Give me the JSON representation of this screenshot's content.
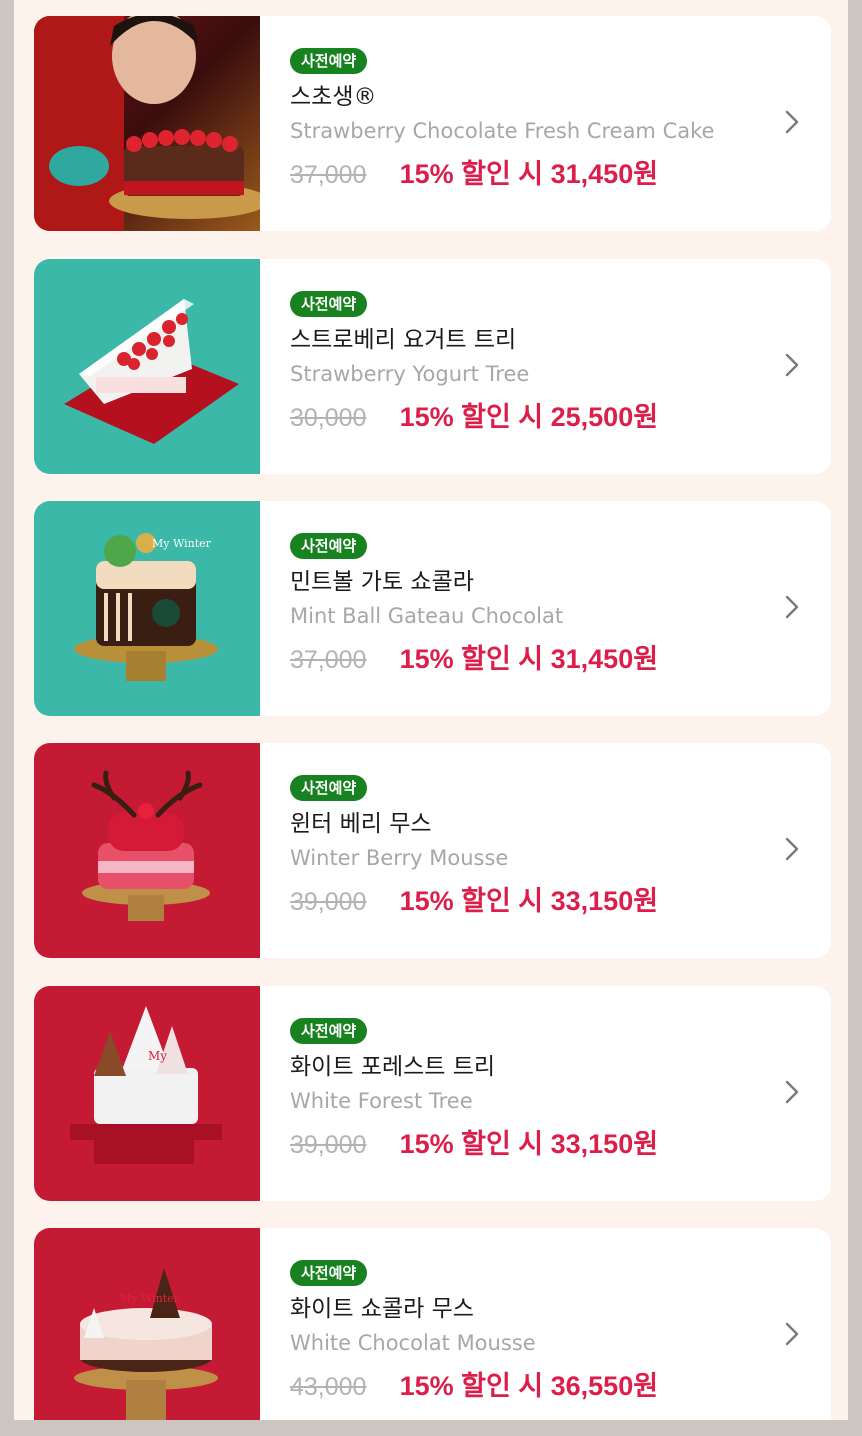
{
  "products": [
    {
      "badge": "사전예약",
      "name_ko": "스초생®",
      "name_en": "Strawberry Chocolate Fresh Cream Cake",
      "original_price": "37,000",
      "sale_text": "15% 할인 시 31,450원",
      "image_theme": "photo-dark-red"
    },
    {
      "badge": "사전예약",
      "name_ko": "스트로베리 요거트 트리",
      "name_en": "Strawberry Yogurt Tree",
      "original_price": "30,000",
      "sale_text": "15% 할인 시 25,500원",
      "image_theme": "mint"
    },
    {
      "badge": "사전예약",
      "name_ko": "민트볼 가토 쇼콜라",
      "name_en": "Mint Ball Gateau Chocolat",
      "original_price": "37,000",
      "sale_text": "15% 할인 시 31,450원",
      "image_theme": "mint"
    },
    {
      "badge": "사전예약",
      "name_ko": "윈터 베리 무스",
      "name_en": "Winter Berry Mousse",
      "original_price": "39,000",
      "sale_text": "15% 할인 시 33,150원",
      "image_theme": "red"
    },
    {
      "badge": "사전예약",
      "name_ko": "화이트 포레스트 트리",
      "name_en": "White Forest Tree",
      "original_price": "39,000",
      "sale_text": "15% 할인 시 33,150원",
      "image_theme": "red"
    },
    {
      "badge": "사전예약",
      "name_ko": "화이트 쇼콜라 무스",
      "name_en": "White Chocolat Mousse",
      "original_price": "43,000",
      "sale_text": "15% 할인 시 36,550원",
      "image_theme": "red"
    }
  ],
  "icons": {
    "chevron": "chevron-right-icon"
  },
  "colors": {
    "badge": "#17821f",
    "sale": "#db1f4a",
    "old_price": "#b3b3b3",
    "mint_bg": "#3cb8a8",
    "red_bg": "#c41a34",
    "page_bg": "#fdf3ec"
  }
}
